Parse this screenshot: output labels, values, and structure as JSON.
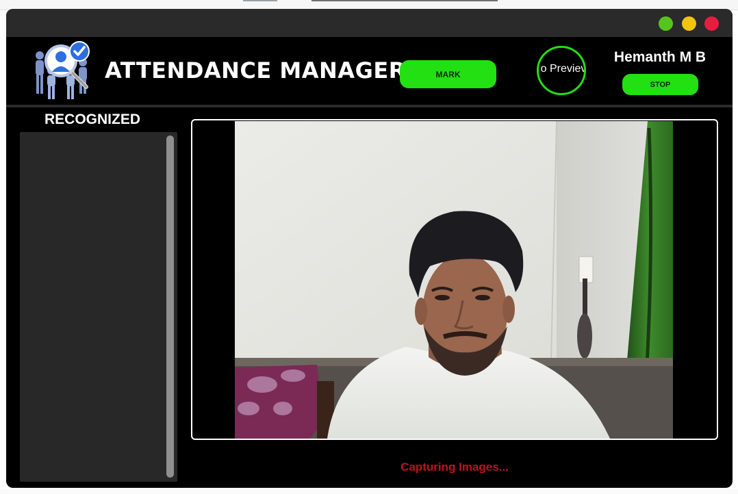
{
  "window": {
    "controls": [
      "green",
      "yellow",
      "red"
    ],
    "control_colors": {
      "green": "#55c51d",
      "yellow": "#f1c40f",
      "red": "#e41e3f"
    }
  },
  "header": {
    "logo_icon": "attendance-search-icon",
    "title": "ATTENDANCE MANAGER",
    "mark_button": "MARK",
    "preview_text": "o Previev",
    "user_name": "Hemanth M B",
    "stop_button": "STOP",
    "accent_color": "#22e011"
  },
  "sidebar": {
    "title": "RECOGNIZED",
    "items": []
  },
  "main": {
    "video_feed": "camera-feed",
    "status": "Capturing Images...",
    "status_color": "#c0121f"
  }
}
